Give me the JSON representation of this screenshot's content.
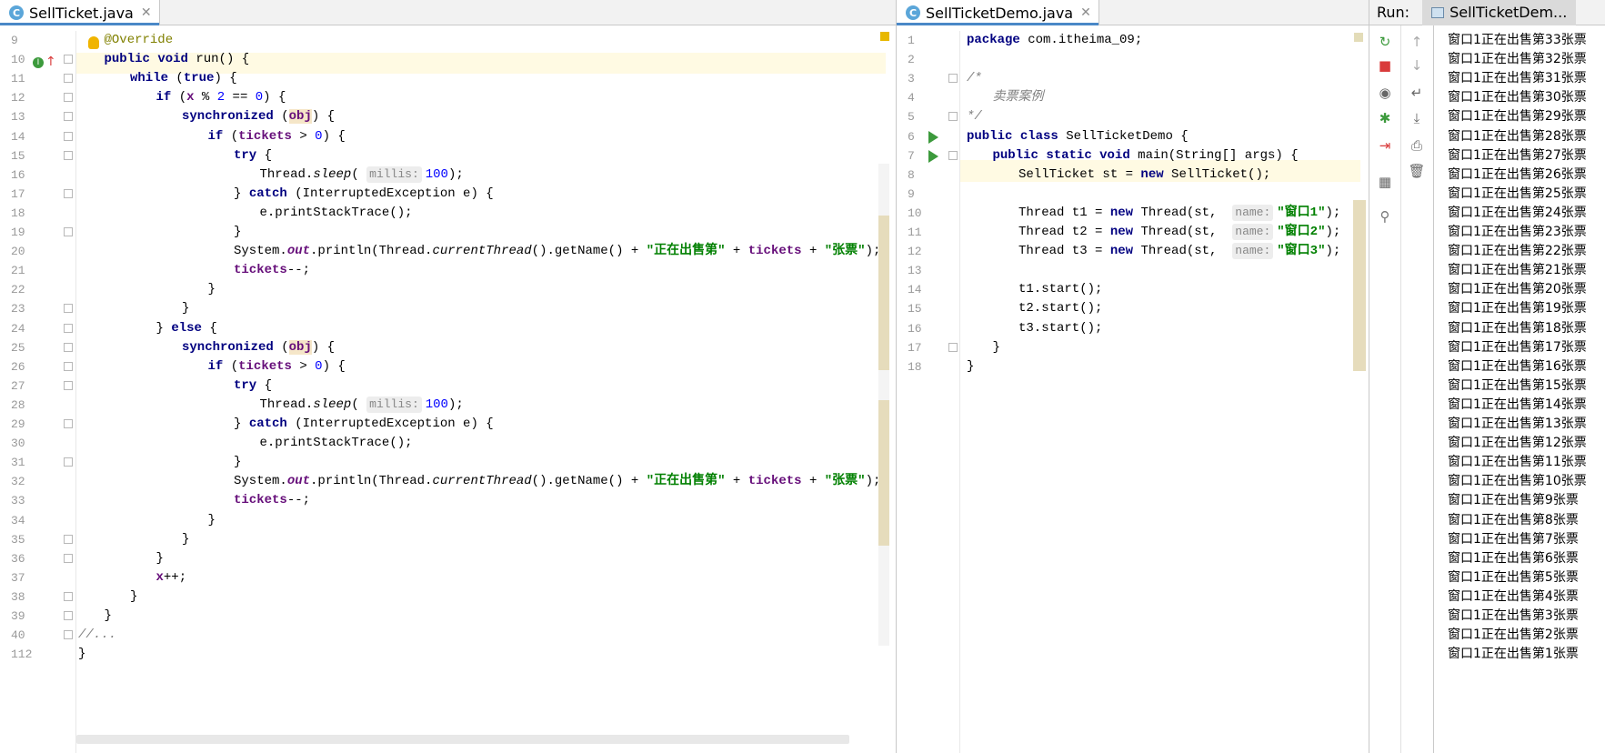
{
  "left_editor": {
    "tab_label": "SellTicket.java",
    "line_numbers": [
      "9",
      "10",
      "11",
      "12",
      "13",
      "14",
      "15",
      "16",
      "17",
      "18",
      "19",
      "20",
      "21",
      "22",
      "23",
      "24",
      "25",
      "26",
      "27",
      "28",
      "29",
      "30",
      "31",
      "32",
      "33",
      "34",
      "35",
      "36",
      "37",
      "38",
      "39",
      "40",
      "112"
    ],
    "lines": [
      "@Override",
      "public void run() {",
      "while (true) {",
      "if (x % 2 == 0) {",
      "synchronized (obj) {",
      "if (tickets > 0) {",
      "try {",
      "Thread.sleep( millis: 100);",
      "} catch (InterruptedException e) {",
      "e.printStackTrace();",
      "}",
      "System.out.println(Thread.currentThread().getName() + \"正在出售第\" + tickets + \"张票\");",
      "tickets--;",
      "}",
      "}",
      "} else {",
      "synchronized (obj) {",
      "if (tickets > 0) {",
      "try {",
      "Thread.sleep( millis: 100);",
      "} catch (InterruptedException e) {",
      "e.printStackTrace();",
      "}",
      "System.out.println(Thread.currentThread().getName() + \"正在出售第\" + tickets + \"张票\");",
      "tickets--;",
      "}",
      "}",
      "}",
      "x++;",
      "}",
      "}",
      "//...",
      "}"
    ]
  },
  "right_editor": {
    "tab_label": "SellTicketDemo.java",
    "line_numbers": [
      "1",
      "2",
      "3",
      "4",
      "5",
      "6",
      "7",
      "8",
      "9",
      "10",
      "11",
      "12",
      "13",
      "14",
      "15",
      "16",
      "17",
      "18"
    ],
    "lines": [
      "package com.itheima_09;",
      "",
      "/*",
      "卖票案例",
      "*/",
      "public class SellTicketDemo {",
      "public static void main(String[] args) {",
      "SellTicket st = new SellTicket();",
      "",
      "Thread t1 = new Thread(st,  name: \"窗口1\");",
      "Thread t2 = new Thread(st,  name: \"窗口2\");",
      "Thread t3 = new Thread(st,  name: \"窗口3\");",
      "",
      "t1.start();",
      "t2.start();",
      "t3.start();",
      "}",
      "}"
    ]
  },
  "run_panel": {
    "label": "Run:",
    "config_tab": "SellTicketDem...",
    "output": [
      "窗口1正在出售第33张票",
      "窗口1正在出售第32张票",
      "窗口1正在出售第31张票",
      "窗口1正在出售第30张票",
      "窗口1正在出售第29张票",
      "窗口1正在出售第28张票",
      "窗口1正在出售第27张票",
      "窗口1正在出售第26张票",
      "窗口1正在出售第25张票",
      "窗口1正在出售第24张票",
      "窗口1正在出售第23张票",
      "窗口1正在出售第22张票",
      "窗口1正在出售第21张票",
      "窗口1正在出售第20张票",
      "窗口1正在出售第19张票",
      "窗口1正在出售第18张票",
      "窗口1正在出售第17张票",
      "窗口1正在出售第16张票",
      "窗口1正在出售第15张票",
      "窗口1正在出售第14张票",
      "窗口1正在出售第13张票",
      "窗口1正在出售第12张票",
      "窗口1正在出售第11张票",
      "窗口1正在出售第10张票",
      "窗口1正在出售第9张票",
      "窗口1正在出售第8张票",
      "窗口1正在出售第7张票",
      "窗口1正在出售第6张票",
      "窗口1正在出售第5张票",
      "窗口1正在出售第4张票",
      "窗口1正在出售第3张票",
      "窗口1正在出售第2张票",
      "窗口1正在出售第1张票"
    ],
    "toolbar_left": [
      "rerun-icon",
      "stop-icon",
      "camera-icon",
      "debug-icon",
      "exit-icon",
      "layout-icon",
      "pin-icon"
    ],
    "toolbar_right": [
      "up-arrow-icon",
      "down-arrow-icon",
      "soft-wrap-icon",
      "scroll-to-end-icon",
      "print-icon",
      "trash-icon"
    ]
  },
  "colors": {
    "keyword": "#000080",
    "string": "#008000",
    "field": "#660e7a",
    "number": "#0000ff",
    "comment": "#808080",
    "annotation": "#808000",
    "run_green": "#3c9a3c",
    "stop_red": "#d93b3b"
  }
}
